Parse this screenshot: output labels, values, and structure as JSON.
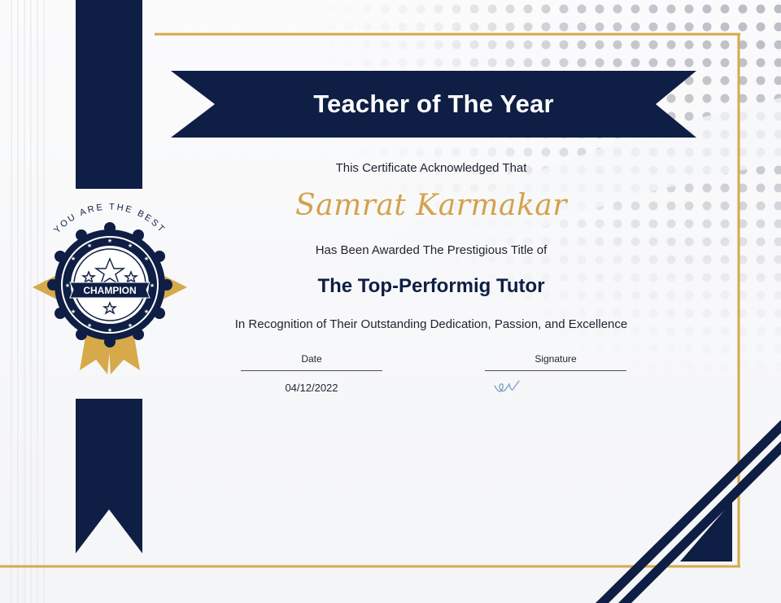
{
  "certificate": {
    "title": "Teacher of The Year",
    "acknowledgement": "This Certificate Acknowledged That",
    "recipient_name": "Samrat Karmakar",
    "awarded_text": "Has Been Awarded The Prestigious Title of",
    "award_title": "The Top-Performig Tutor",
    "recognition_text": "In Recognition of Their Outstanding Dedication, Passion, and Excellence",
    "date_label": "Date",
    "date_value": "04/12/2022",
    "signature_label": "Signature"
  },
  "badge": {
    "arc_text": "YOU ARE THE BEST",
    "label": "CHAMPION"
  },
  "colors": {
    "navy": "#0f1e44",
    "gold": "#d6a94a",
    "dots": "#b8bcc3"
  },
  "icons": {
    "badge": "champion-rosette-icon",
    "signature": "signature-scribble-icon"
  }
}
